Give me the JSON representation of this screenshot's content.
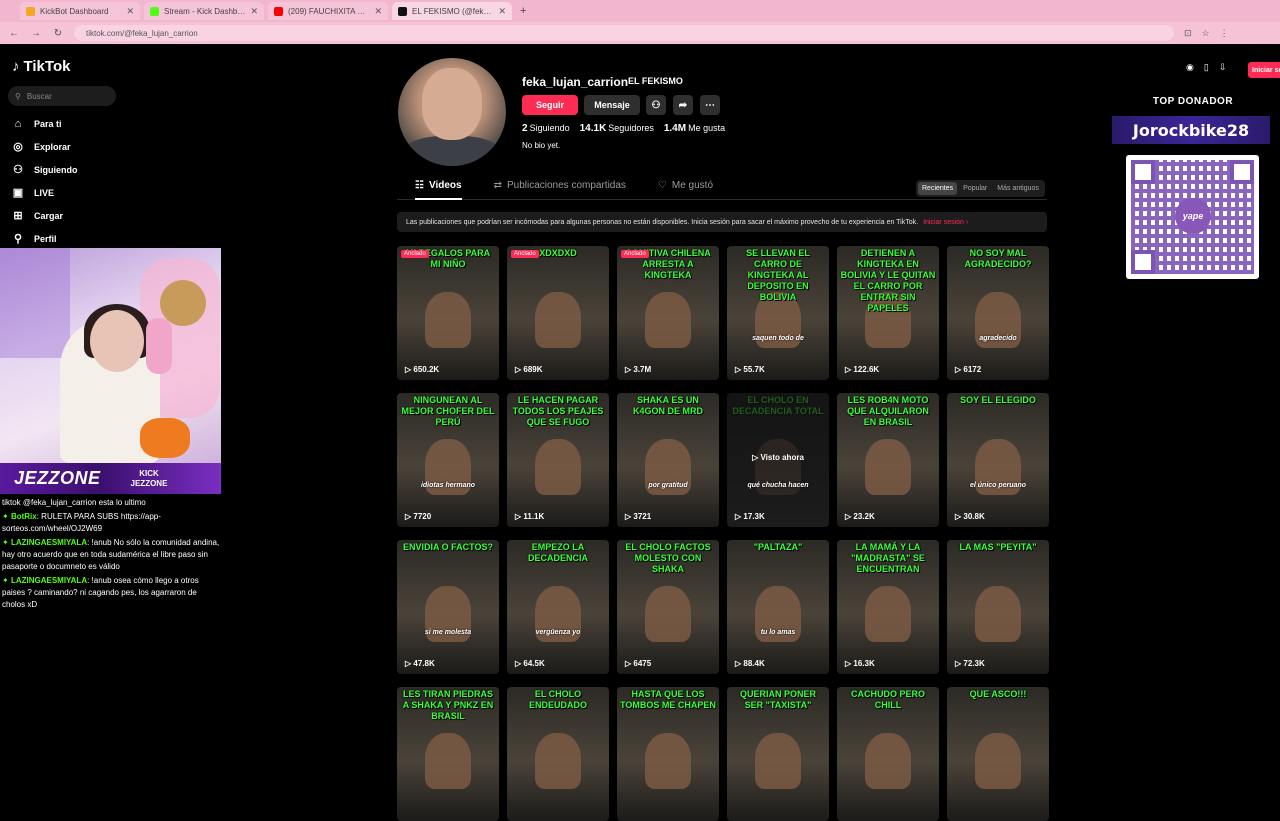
{
  "browser": {
    "tabs": [
      {
        "title": "KickBot Dashboard",
        "color": "#f5a623"
      },
      {
        "title": "Stream - Kick Dashboard",
        "color": "#53fc18"
      },
      {
        "title": "(209) FAUCHIXITA CONFIRMA C",
        "color": "#ff0000"
      },
      {
        "title": "EL FEKISMO (@feka_lujan",
        "color": "#111111"
      }
    ],
    "url": "tiktok.com/@feka_lujan_carrion"
  },
  "tiktok": {
    "logo": "TikTok",
    "search_placeholder": "Buscar",
    "nav": [
      {
        "label": "Para ti",
        "icon": "home-icon",
        "glyph": "⌂"
      },
      {
        "label": "Explorar",
        "icon": "compass-icon",
        "glyph": "◎"
      },
      {
        "label": "Siguiendo",
        "icon": "following-icon",
        "glyph": "⚇"
      },
      {
        "label": "LIVE",
        "icon": "live-icon",
        "glyph": "▣"
      },
      {
        "label": "Cargar",
        "icon": "upload-icon",
        "glyph": "⊞"
      },
      {
        "label": "Perfil",
        "icon": "profile-icon",
        "glyph": "⚲"
      }
    ]
  },
  "stream": {
    "brand": "JEZZONE",
    "kick_label": "KICK",
    "kick_name": "JEZZONE",
    "chat": [
      {
        "user": "",
        "text": "tiktok @feka_lujan_carrion esta lo ultimo"
      },
      {
        "user": "BotRix",
        "text": ": RULETA PARA SUBS https://app-sorteos.com/wheel/OJ2W69"
      },
      {
        "user": "LAZINGAESMIYALA",
        "text": ": !anub No sólo la comunidad andina, hay otro acuerdo que en toda sudamérica el libre paso sin pasaporte o documneto es válido"
      },
      {
        "user": "LAZINGAESMIYALA",
        "text": ": !anub osea cómo llego a otros paises ? caminando? ni cagando pes, los agarraron de cholos xD"
      }
    ],
    "top_donor_title": "TOP DONADOR",
    "top_donor_name": "Jorockbike28",
    "qr_brand": "yape"
  },
  "profile": {
    "username": "feka_lujan_carrion",
    "nickname": "EL FEKISMO",
    "follow_label": "Seguir",
    "message_label": "Mensaje",
    "stats": {
      "following": "2",
      "following_label": "Siguiendo",
      "followers": "14.1K",
      "followers_label": "Seguidores",
      "likes": "1.4M",
      "likes_label": "Me gusta"
    },
    "bio": "No bio yet.",
    "tabs": [
      "Videos",
      "Publicaciones compartidas",
      "Me gustó"
    ],
    "sort": [
      "Recientes",
      "Popular",
      "Más antiguos"
    ],
    "notice": "Las publicaciones que podrían ser incómodas para algunas personas no están disponibles. Inicia sesión para sacar el máximo provecho de tu experiencia en TikTok.",
    "notice_link": "Iniciar sesión",
    "login_button": "Iniciar se",
    "pinned_label": "Anclado",
    "watched_label": "Visto ahora"
  },
  "videos": [
    {
      "overlay": "MI REGALOS PARA MI NIÑO",
      "views": "650.2K",
      "pinned": true,
      "caption": ""
    },
    {
      "overlay": "XDXDXD",
      "views": "689K",
      "pinned": true,
      "caption": ""
    },
    {
      "overlay": "COMITIVA CHILENA ARRESTA A KINGTEKA",
      "views": "3.7M",
      "pinned": true,
      "caption": ""
    },
    {
      "overlay": "SE LLEVAN EL CARRO DE KINGTEKA AL DEPOSITO EN BOLIVIA",
      "views": "55.7K",
      "pinned": false,
      "caption": "saquen todo de"
    },
    {
      "overlay": "DETIENEN A KINGTEKA EN BOLIVIA Y LE QUITAN EL CARRO POR ENTRAR SIN PAPELES",
      "views": "122.6K",
      "pinned": false,
      "caption": ""
    },
    {
      "overlay": "NO SOY MAL AGRADECIDO?",
      "views": "6172",
      "pinned": false,
      "caption": "agradecido"
    },
    {
      "overlay": "NINGUNEAN AL MEJOR CHOFER DEL PERÚ",
      "views": "7720",
      "pinned": false,
      "caption": "idiotas hermano"
    },
    {
      "overlay": "LE HACEN PAGAR TODOS LOS PEAJES QUE SE FUGO",
      "views": "11.1K",
      "pinned": false,
      "caption": ""
    },
    {
      "overlay": "SHAKA ES UN K4GON DE MRD",
      "views": "3721",
      "pinned": false,
      "caption": "por gratitud"
    },
    {
      "overlay": "EL CHOLO EN DECADENCIA TOTAL",
      "views": "17.3K",
      "pinned": false,
      "caption": "qué chucha hacen",
      "watched": true
    },
    {
      "overlay": "LES ROB4N MOTO QUE ALQUILARON EN BRASIL",
      "views": "23.2K",
      "pinned": false,
      "caption": ""
    },
    {
      "overlay": "SOY EL ELEGIDO",
      "views": "30.8K",
      "pinned": false,
      "caption": "el único peruano"
    },
    {
      "overlay": "ENVIDIA O FACTOS?",
      "views": "47.8K",
      "pinned": false,
      "caption": "si me molesta"
    },
    {
      "overlay": "EMPEZO LA DECADENCIA",
      "views": "64.5K",
      "pinned": false,
      "caption": "vergüenza yo"
    },
    {
      "overlay": "EL CHOLO FACTOS MOLESTO CON SHAKA",
      "views": "6475",
      "pinned": false,
      "caption": ""
    },
    {
      "overlay": "\"PALTAZA\"",
      "views": "88.4K",
      "pinned": false,
      "caption": "tu lo amas"
    },
    {
      "overlay": "LA MAMÁ Y LA \"MADRASTA\" SE ENCUENTRAN",
      "views": "16.3K",
      "pinned": false,
      "caption": ""
    },
    {
      "overlay": "LA MAS \"PEYITA\"",
      "views": "72.3K",
      "pinned": false,
      "caption": ""
    },
    {
      "overlay": "LES TIRAN PIEDRAS A SHAKA Y PNKZ EN BRASIL",
      "views": "",
      "pinned": false,
      "caption": ""
    },
    {
      "overlay": "EL CHOLO ENDEUDADO",
      "views": "",
      "pinned": false,
      "caption": ""
    },
    {
      "overlay": "HASTA QUE LOS TOMBOS ME CHAPEN",
      "views": "",
      "pinned": false,
      "caption": ""
    },
    {
      "overlay": "QUERIAN PONER SER \"TAXISTA\"",
      "views": "",
      "pinned": false,
      "caption": ""
    },
    {
      "overlay": "CACHUDO PERO CHILL",
      "views": "",
      "pinned": false,
      "caption": ""
    },
    {
      "overlay": "QUE ASCO!!!",
      "views": "",
      "pinned": false,
      "caption": ""
    }
  ]
}
